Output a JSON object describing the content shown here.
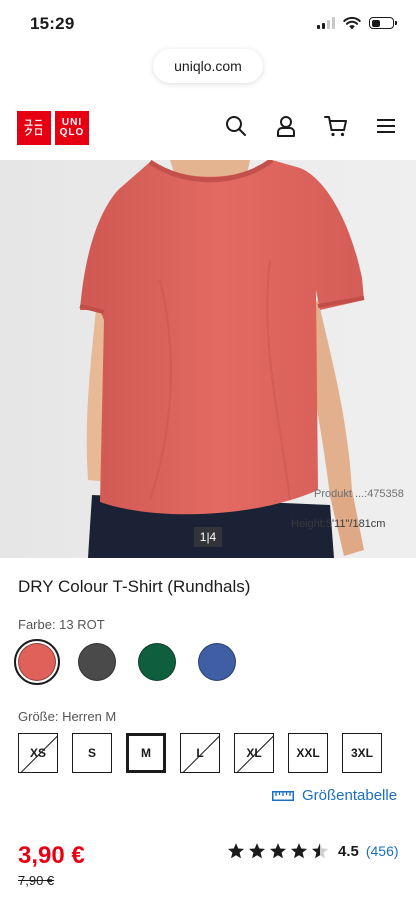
{
  "status_bar": {
    "time": "15:29"
  },
  "browser": {
    "url": "uniqlo.com"
  },
  "brand": {
    "logo_jp_top": "ユニ",
    "logo_jp_bottom": "クロ",
    "logo_en_top": "UNI",
    "logo_en_bottom": "QLO",
    "accent": "#e60012"
  },
  "header": {
    "icons": [
      "search-icon",
      "account-icon",
      "cart-icon",
      "menu-icon"
    ]
  },
  "hero": {
    "product_code": "Produkt ...:475358",
    "model_height": "Height:5'11\"/181cm",
    "pager": "1|4"
  },
  "product": {
    "title": "DRY Colour T-Shirt (Rundhals)",
    "color_label": "Farbe: 13 ROT",
    "colors": [
      {
        "name": "ROT",
        "hex": "#e0615a",
        "selected": true
      },
      {
        "name": "dark-gray",
        "hex": "#4a4a4a",
        "selected": false
      },
      {
        "name": "green",
        "hex": "#0f5f3f",
        "selected": false
      },
      {
        "name": "blue",
        "hex": "#3f5ea3",
        "selected": false
      }
    ],
    "size_label": "Größe: Herren M",
    "sizes": [
      {
        "label": "XS",
        "available": false,
        "selected": false
      },
      {
        "label": "S",
        "available": true,
        "selected": false
      },
      {
        "label": "M",
        "available": true,
        "selected": true
      },
      {
        "label": "L",
        "available": false,
        "selected": false
      },
      {
        "label": "XL",
        "available": false,
        "selected": false
      },
      {
        "label": "XXL",
        "available": true,
        "selected": false
      },
      {
        "label": "3XL",
        "available": true,
        "selected": false
      }
    ],
    "size_chart_label": "Größentabelle",
    "price": "3,90 €",
    "old_price": "7,90 €",
    "rating_value": "4.5",
    "rating_count": "(456)",
    "rating": 4.5,
    "link_color": "#1a6fbf"
  }
}
